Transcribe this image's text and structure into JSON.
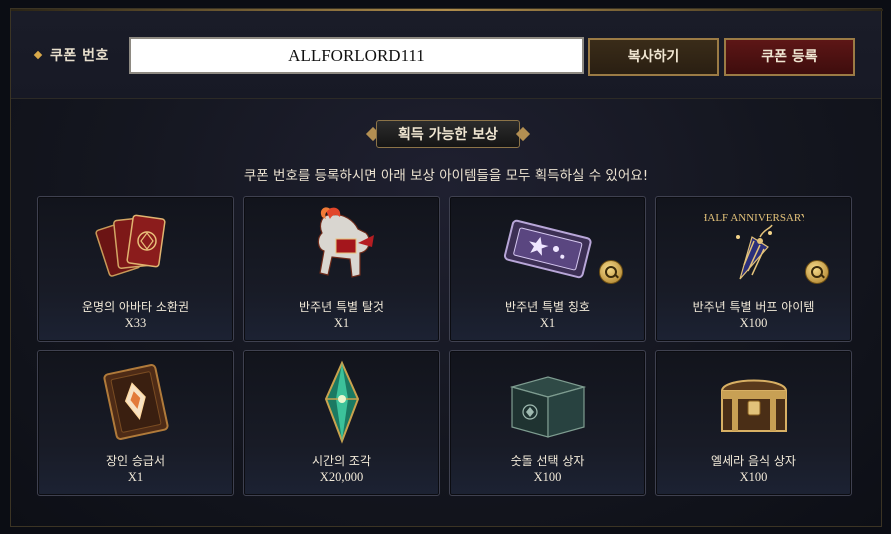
{
  "coupon": {
    "label": "쿠폰 번호",
    "value": "ALLFORLORD111",
    "copy_label": "복사하기",
    "register_label": "쿠폰 등록"
  },
  "rewards_section": {
    "title": "획득 가능한 보상",
    "subtitle": "쿠폰 번호를 등록하시면 아래 보상 아이템들을 모두 획득하실 수 있어요!"
  },
  "rewards": [
    {
      "name": "운명의 아바타 소환권",
      "qty": "X33",
      "icon": "summon-cards-icon",
      "magnifier": false
    },
    {
      "name": "반주년 특별 탈것",
      "qty": "X1",
      "icon": "mount-icon",
      "magnifier": false
    },
    {
      "name": "반주년 특별 칭호",
      "qty": "X1",
      "icon": "title-ticket-icon",
      "magnifier": true
    },
    {
      "name": "반주년 특별 버프 아이템",
      "qty": "X100",
      "icon": "party-horn-icon",
      "magnifier": true,
      "badge": "HALF ANNIVERSARY"
    },
    {
      "name": "장인 승급서",
      "qty": "X1",
      "icon": "book-icon",
      "magnifier": false
    },
    {
      "name": "시간의 조각",
      "qty": "X20,000",
      "icon": "crystal-icon",
      "magnifier": false
    },
    {
      "name": "숫돌 선택 상자",
      "qty": "X100",
      "icon": "whetstone-box-icon",
      "magnifier": false
    },
    {
      "name": "엘세라 음식 상자",
      "qty": "X100",
      "icon": "treasure-chest-icon",
      "magnifier": false
    }
  ],
  "colors": {
    "accent_gold": "#b08d4c",
    "register_red": "#5d1616",
    "panel_bg": "#14161f"
  }
}
